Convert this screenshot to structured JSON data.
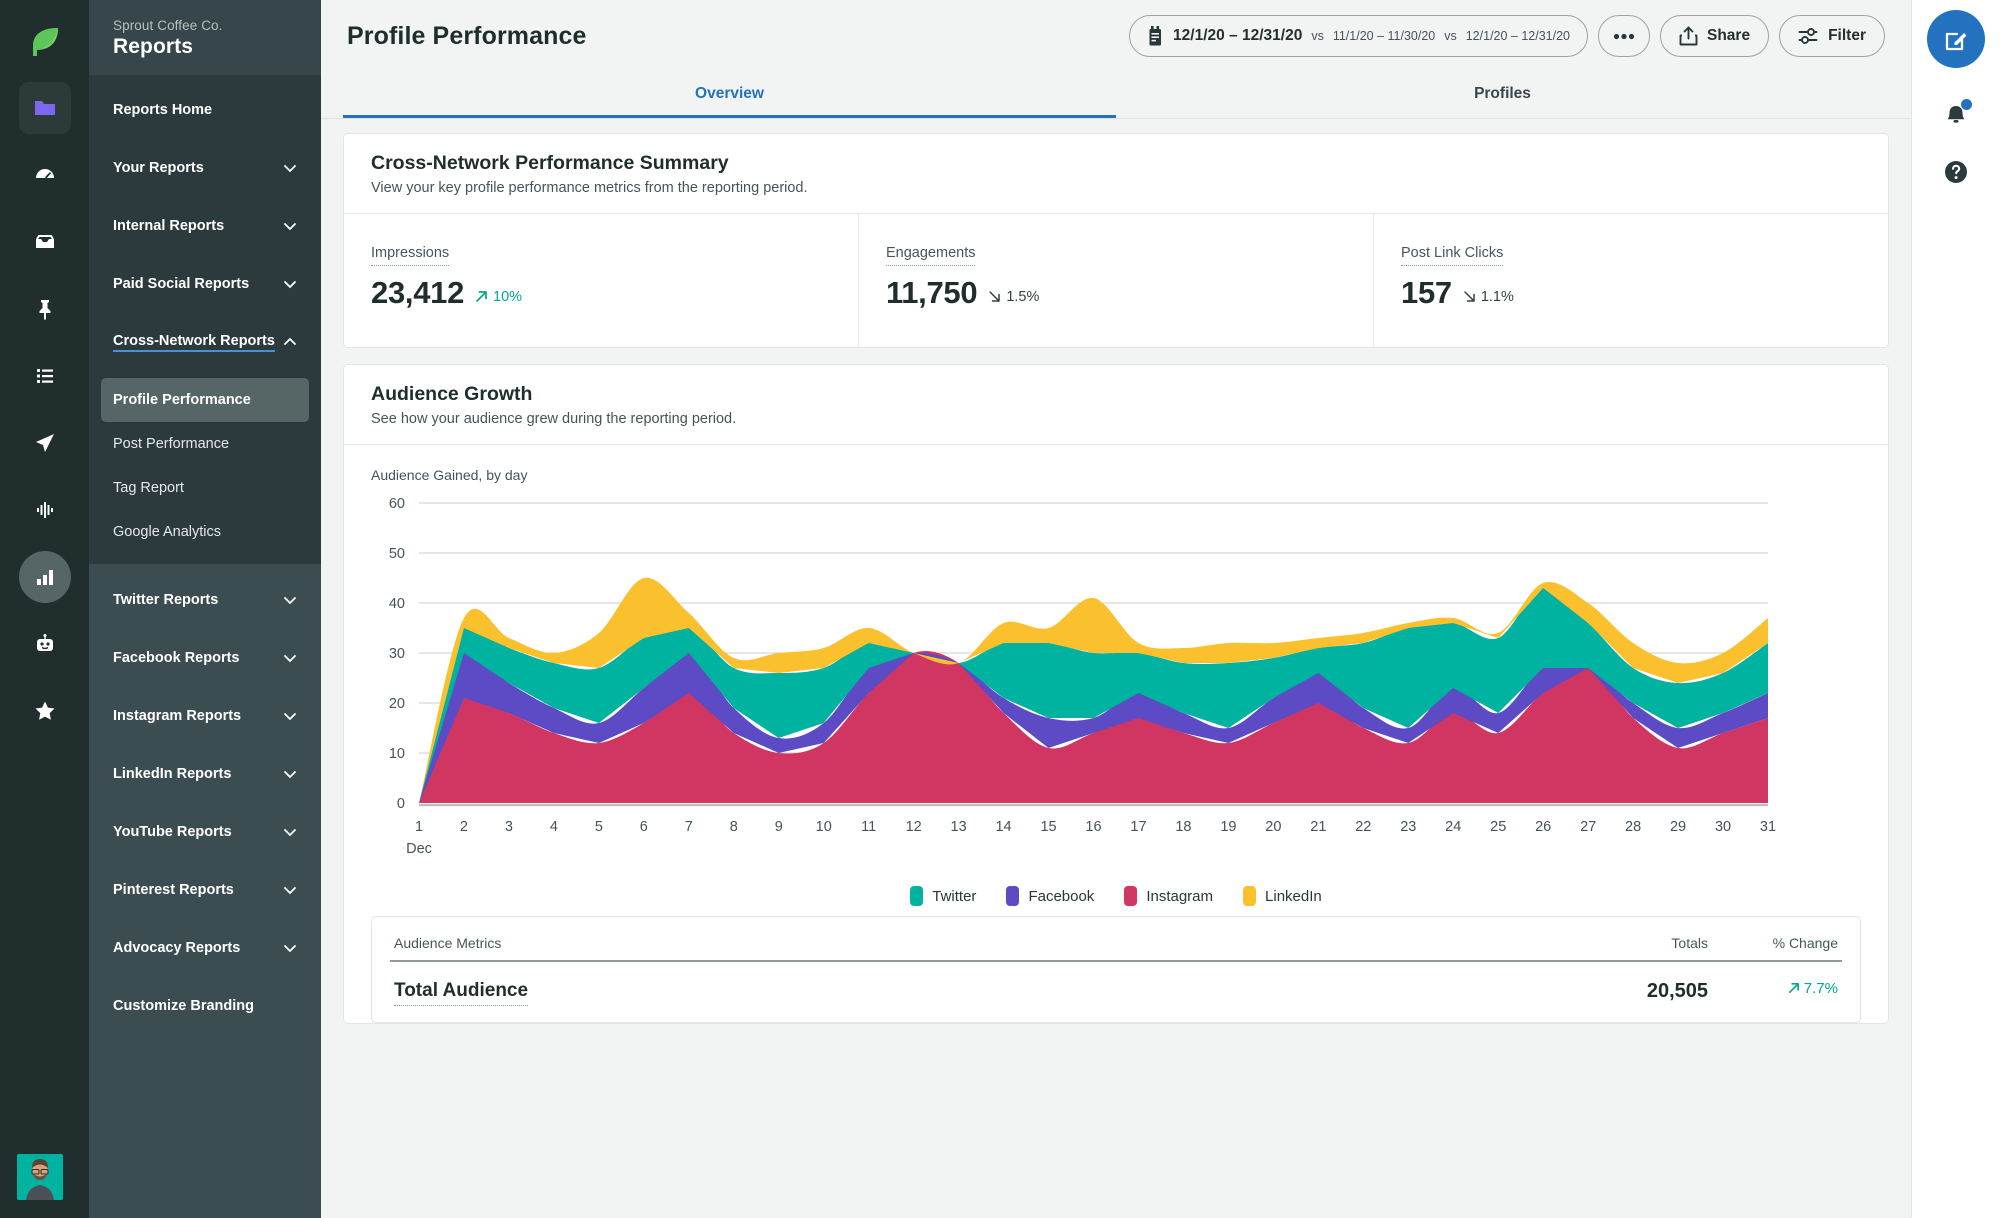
{
  "brand": {
    "logo_icon": "sprout-leaf-logo",
    "accent_blue": "#2272bf",
    "teal": "#00b2a0",
    "sidebar_bg": "#36464a"
  },
  "icon_rail": {
    "items": [
      {
        "icon": "dashboard-icon",
        "name": "rail-item-dashboard"
      },
      {
        "icon": "inbox-icon",
        "name": "rail-item-inbox"
      },
      {
        "icon": "pin-icon",
        "name": "rail-item-pinned"
      },
      {
        "icon": "list-icon",
        "name": "rail-item-tasks"
      },
      {
        "icon": "send-icon",
        "name": "rail-item-publishing"
      },
      {
        "icon": "listening-icon",
        "name": "rail-item-listening"
      },
      {
        "icon": "reports-bar-icon",
        "name": "rail-item-reports"
      },
      {
        "icon": "bot-icon",
        "name": "rail-item-bots"
      },
      {
        "icon": "star-icon",
        "name": "rail-item-reviews"
      }
    ]
  },
  "sidebar": {
    "org": "Sprout Coffee Co.",
    "title": "Reports",
    "home_label": "Reports Home",
    "groups_top": [
      {
        "label": "Your Reports",
        "expanded": false
      },
      {
        "label": "Internal Reports",
        "expanded": false
      },
      {
        "label": "Paid Social Reports",
        "expanded": false
      },
      {
        "label": "Cross-Network Reports",
        "expanded": true
      }
    ],
    "cross_network_children": [
      {
        "label": "Profile Performance",
        "selected": true
      },
      {
        "label": "Post Performance",
        "selected": false
      },
      {
        "label": "Tag Report",
        "selected": false
      },
      {
        "label": "Google Analytics",
        "selected": false
      }
    ],
    "groups_bottom": [
      {
        "label": "Twitter Reports",
        "expanded": false
      },
      {
        "label": "Facebook Reports",
        "expanded": false
      },
      {
        "label": "Instagram Reports",
        "expanded": false
      },
      {
        "label": "LinkedIn Reports",
        "expanded": false
      },
      {
        "label": "YouTube Reports",
        "expanded": false
      },
      {
        "label": "Pinterest Reports",
        "expanded": false
      },
      {
        "label": "Advocacy Reports",
        "expanded": false
      }
    ],
    "customize_label": "Customize Branding"
  },
  "header": {
    "page_title": "Profile Performance",
    "date_range": {
      "icon": "calendar-icon",
      "primary": "12/1/20 – 12/31/20",
      "compare_1_prefix": "vs",
      "compare_1": "11/1/20 – 11/30/20",
      "compare_2_prefix": "vs",
      "compare_2": "12/1/20 – 12/31/20"
    },
    "more_label": "•••",
    "share_label": "Share",
    "filter_label": "Filter"
  },
  "tabs": [
    {
      "label": "Overview",
      "active": true
    },
    {
      "label": "Profiles",
      "active": false
    }
  ],
  "summary_card": {
    "title": "Cross-Network Performance Summary",
    "subtitle": "View your key profile performance metrics from the reporting period.",
    "metrics": [
      {
        "label": "Impressions",
        "value": "23,412",
        "delta": "10%",
        "direction": "up"
      },
      {
        "label": "Engagements",
        "value": "11,750",
        "delta": "1.5%",
        "direction": "down"
      },
      {
        "label": "Post Link Clicks",
        "value": "157",
        "delta": "1.1%",
        "direction": "down"
      }
    ]
  },
  "audience_card": {
    "title": "Audience Growth",
    "subtitle": "See how your audience grew during the reporting period.",
    "table": {
      "col_metric": "Audience Metrics",
      "col_totals": "Totals",
      "col_change": "% Change",
      "rows": [
        {
          "metric": "Total Audience",
          "total": "20,505",
          "change": "7.7%",
          "direction": "up"
        }
      ]
    }
  },
  "chart_data": {
    "type": "area",
    "stacked": true,
    "title": "Audience Gained, by day",
    "xlabel": "Dec",
    "ylabel": "",
    "ylim": [
      0,
      60
    ],
    "yticks": [
      0,
      10,
      20,
      30,
      40,
      50,
      60
    ],
    "grid": true,
    "legend_position": "bottom",
    "x": [
      1,
      2,
      3,
      4,
      5,
      6,
      7,
      8,
      9,
      10,
      11,
      12,
      13,
      14,
      15,
      16,
      17,
      18,
      19,
      20,
      21,
      22,
      23,
      24,
      25,
      26,
      27,
      28,
      29,
      30,
      31
    ],
    "xtick_labels": [
      "1",
      "2",
      "3",
      "4",
      "5",
      "6",
      "7",
      "8",
      "9",
      "10",
      "11",
      "12",
      "13",
      "14",
      "15",
      "16",
      "17",
      "18",
      "19",
      "20",
      "21",
      "22",
      "23",
      "24",
      "25",
      "26",
      "27",
      "28",
      "29",
      "30",
      "31"
    ],
    "series": [
      {
        "name": "Instagram",
        "color": "#d13562",
        "values": [
          0,
          21,
          18,
          14,
          12,
          16,
          22,
          14,
          10,
          12,
          22,
          30,
          28,
          18,
          11,
          14,
          17,
          14,
          12,
          16,
          20,
          15,
          12,
          18,
          14,
          22,
          27,
          17,
          11,
          14,
          17
        ]
      },
      {
        "name": "Facebook",
        "color": "#5c4bc4",
        "values": [
          0,
          9,
          6,
          5,
          4,
          7,
          8,
          5,
          3,
          4,
          5,
          0,
          0,
          3,
          6,
          3,
          5,
          4,
          3,
          5,
          6,
          4,
          3,
          5,
          4,
          5,
          0,
          3,
          4,
          4,
          5
        ]
      },
      {
        "name": "Twitter",
        "color": "#00b2a0",
        "values": [
          0,
          5,
          7,
          9,
          11,
          10,
          5,
          8,
          13,
          11,
          5,
          0,
          0,
          11,
          15,
          13,
          8,
          10,
          13,
          8,
          5,
          13,
          20,
          13,
          15,
          16,
          9,
          7,
          9,
          8,
          10
        ]
      },
      {
        "name": "LinkedIn",
        "color": "#fbc02d",
        "values": [
          0,
          2,
          2,
          2,
          7,
          12,
          3,
          2,
          4,
          4,
          3,
          0,
          0,
          4,
          3,
          11,
          2,
          3,
          4,
          3,
          2,
          2,
          1,
          1,
          1,
          1,
          4,
          5,
          4,
          4,
          5
        ]
      }
    ],
    "legend": [
      {
        "label": "Twitter",
        "color": "#00b2a0"
      },
      {
        "label": "Facebook",
        "color": "#5c4bc4"
      },
      {
        "label": "Instagram",
        "color": "#d13562"
      },
      {
        "label": "LinkedIn",
        "color": "#fbc02d"
      }
    ]
  },
  "right_rail": {
    "compose_icon": "compose-pencil-icon",
    "notification_icon": "bell-icon",
    "help_icon": "question-circle-icon",
    "has_notification": true
  }
}
